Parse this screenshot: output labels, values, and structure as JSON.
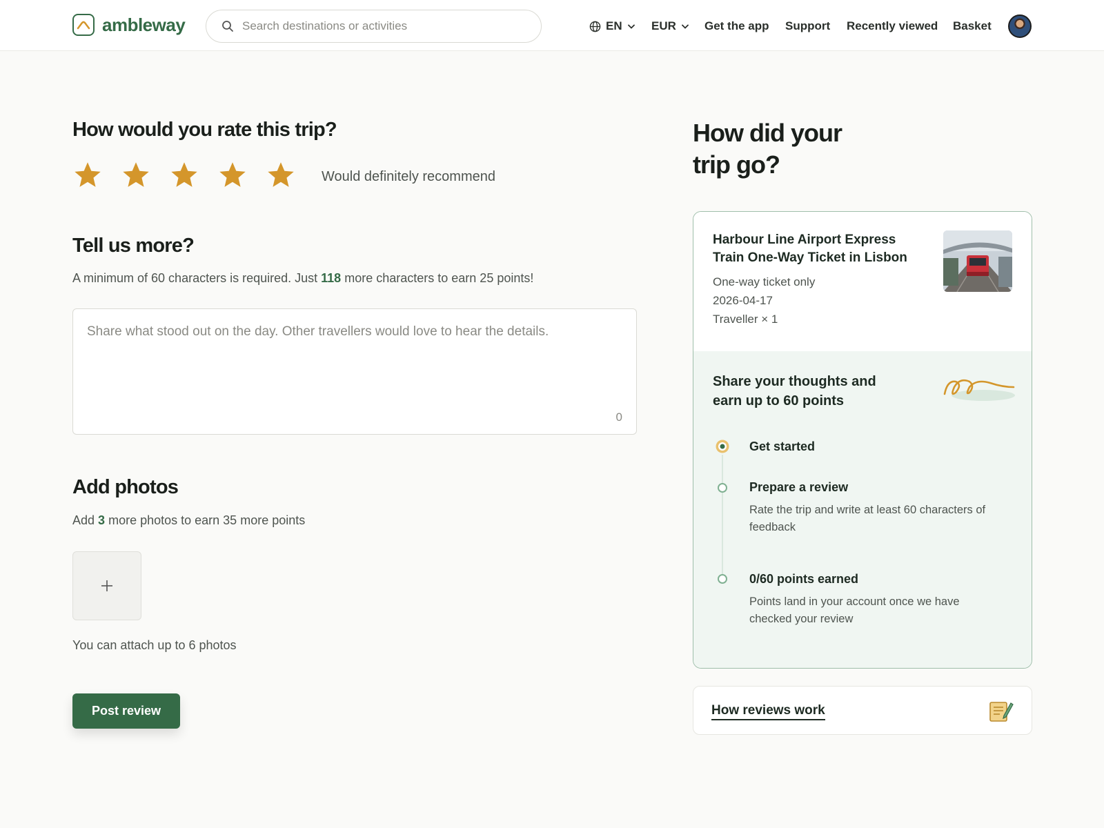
{
  "header": {
    "brand": "ambleway",
    "search_placeholder": "Search destinations or activities",
    "language": "EN",
    "currency": "EUR",
    "get_app": "Get the app",
    "support": "Support",
    "recently_viewed": "Recently viewed",
    "basket": "Basket"
  },
  "rating": {
    "heading": "How would you rate this trip?",
    "stars_selected": 5,
    "stars_max": 5,
    "label": "Would definitely recommend",
    "star_color": "#d4962b"
  },
  "tell_more": {
    "heading": "Tell us more?",
    "sub_prefix": "A minimum of 60 characters is required. Just",
    "remaining": "118",
    "sub_suffix": "more characters to earn 25 points!",
    "placeholder": "Share what stood out on the day. Other travellers would love to hear the details.",
    "count": "0"
  },
  "photos": {
    "heading": "Add photos",
    "sub_prefix": "Add",
    "count": "3",
    "sub_suffix": "more photos to earn 35 more points",
    "limit_text": "You can attach up to 6 photos"
  },
  "post_button": "Post review",
  "sidebar": {
    "heading": "How did your trip go?",
    "product": {
      "title": "Harbour Line Airport Express Train One-Way Ticket in Lisbon",
      "option": "One-way ticket only",
      "date": "2026-04-17",
      "travellers": "Traveller × 1"
    },
    "points_box": {
      "title": "Share your thoughts and earn up to 60 points",
      "steps": [
        {
          "title": "Get started",
          "description": ""
        },
        {
          "title": "Prepare a review",
          "description": "Rate the trip and write at least 60 characters of feedback"
        },
        {
          "title": "0/60 points earned",
          "description": "Points land in your account once we have checked your review"
        }
      ]
    },
    "how_reviews_work": "How reviews work"
  },
  "colors": {
    "brand_green": "#356b47",
    "accent_gold": "#d4962b",
    "panel_mint": "#f0f6f2"
  }
}
